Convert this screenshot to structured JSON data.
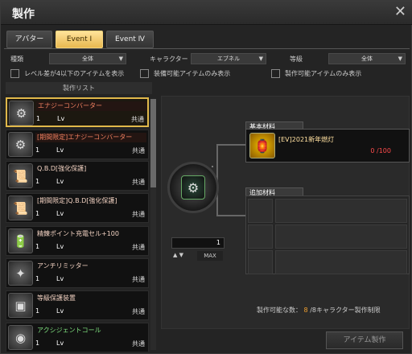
{
  "window": {
    "title": "製作",
    "close_icon": "close-icon"
  },
  "tabs": [
    {
      "label": "アバター",
      "active": false
    },
    {
      "label": "Event Ⅰ",
      "active": true
    },
    {
      "label": "Event Ⅳ",
      "active": false
    }
  ],
  "filters": {
    "type_label": "種類",
    "type_value": "全体",
    "character_label": "キャラクター",
    "character_value": "エブネル",
    "grade_label": "等級",
    "grade_value": "全体"
  },
  "checkboxes": [
    {
      "label": "レベル差が4以下のアイテムを表示",
      "checked": false
    },
    {
      "label": "装備可能アイテムのみ表示",
      "checked": false
    },
    {
      "label": "製作可能アイテムのみ表示",
      "checked": false
    }
  ],
  "list": {
    "header": "製作リスト",
    "items": [
      {
        "name": "エナジーコンバーター",
        "count": "1",
        "lv": "Lv",
        "common": "共通",
        "icon": "energy-converter-icon",
        "style": "red",
        "selected": true
      },
      {
        "name": "[期間限定]エナジーコンバーター",
        "count": "1",
        "lv": "Lv",
        "common": "共通",
        "icon": "energy-converter-icon",
        "style": "red",
        "selected": false
      },
      {
        "name": "Q.B.D[強化保護]",
        "count": "1",
        "lv": "Lv",
        "common": "共通",
        "icon": "protection-scroll-icon",
        "style": "plain",
        "selected": false
      },
      {
        "name": "[期間限定]Q.B.D[強化保護]",
        "count": "1",
        "lv": "Lv",
        "common": "共通",
        "icon": "protection-scroll-icon",
        "style": "plain",
        "selected": false
      },
      {
        "name": "精錬ポイント充電セル+100",
        "count": "1",
        "lv": "Lv",
        "common": "共通",
        "icon": "charge-cell-icon",
        "style": "plain",
        "selected": false
      },
      {
        "name": "アンチリミッター",
        "count": "1",
        "lv": "Lv",
        "common": "共通",
        "icon": "anti-limiter-icon",
        "style": "plain",
        "selected": false
      },
      {
        "name": "等級保護装置",
        "count": "1",
        "lv": "Lv",
        "common": "共通",
        "icon": "grade-protector-icon",
        "style": "plain",
        "selected": false
      },
      {
        "name": "アクシジェントコール",
        "count": "1",
        "lv": "Lv",
        "common": "共通",
        "icon": "accident-call-icon",
        "style": "green",
        "selected": false
      }
    ]
  },
  "craft": {
    "quantity": "1",
    "max_label": "MAX",
    "basic_materials_label": "基本材料",
    "basic_material": {
      "name": "[EV]2021新年燃灯",
      "count": "0 /100",
      "icon": "lantern-icon"
    },
    "additional_materials_label": "追加材料",
    "status_prefix": "製作可能な数：",
    "status_current": "8",
    "status_suffix": "/8キャラクター製作制限",
    "craft_button": "アイテム製作"
  },
  "colors": {
    "accent": "#e0b84a",
    "tab_active": "#f5d37a",
    "material_count": "#ff4b4b"
  }
}
